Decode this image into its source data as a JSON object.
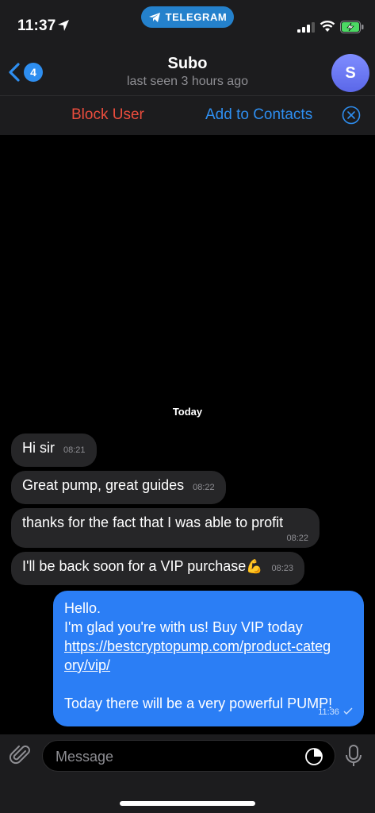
{
  "status_bar": {
    "time": "11:37",
    "app_pill": "TELEGRAM"
  },
  "header": {
    "back_badge": "4",
    "name": "Subo",
    "status": "last seen 3 hours ago",
    "avatar_initial": "S"
  },
  "actions": {
    "block": "Block User",
    "add": "Add to Contacts"
  },
  "chat": {
    "date": "Today",
    "incoming": [
      {
        "text": "Hi sir",
        "time": "08:21"
      },
      {
        "text": "Great pump, great guides",
        "time": "08:22"
      },
      {
        "text": "thanks for the fact that I was able to profit",
        "time": "08:22"
      },
      {
        "text": "I'll be back soon for a VIP purchase",
        "time": "08:23",
        "emoji": "💪"
      }
    ],
    "outgoing": {
      "line1": "Hello.",
      "line2": "I'm glad you're with us! Buy VIP today",
      "link": "https://bestcryptopump.com/product-category/vip/",
      "line3": "Today there will be a very powerful PUMP!",
      "time": "11:36"
    }
  },
  "input": {
    "placeholder": "Message"
  },
  "colors": {
    "accent": "#2e8ef0",
    "danger": "#eb4d3d",
    "outgoing_bubble": "#2b7ef5",
    "incoming_bubble": "#262628"
  }
}
